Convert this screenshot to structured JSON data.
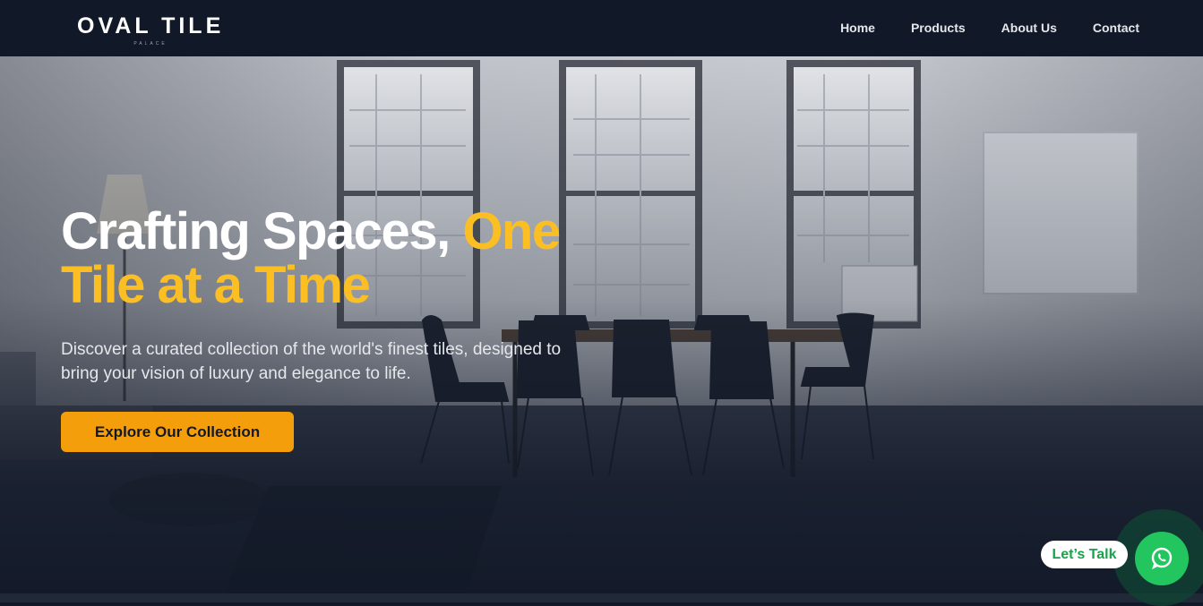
{
  "brand": {
    "name": "OVAL TILE",
    "tagline": "PALACE"
  },
  "nav": {
    "items": [
      {
        "label": "Home"
      },
      {
        "label": "Products"
      },
      {
        "label": "About Us"
      },
      {
        "label": "Contact"
      }
    ]
  },
  "hero": {
    "title_part1": "Crafting Spaces,",
    "title_part2": "One Tile at a Time",
    "subtitle": "Discover a curated collection of the world's finest tiles, designed to bring your vision of luxury and elegance to life.",
    "cta_label": "Explore Our Collection"
  },
  "chat": {
    "label": "Let’s Talk",
    "icon": "whatsapp-icon"
  },
  "colors": {
    "nav_bg": "#111827",
    "accent": "#fbbf24",
    "cta_bg": "#f59e0b",
    "chat_green": "#22c55e"
  }
}
